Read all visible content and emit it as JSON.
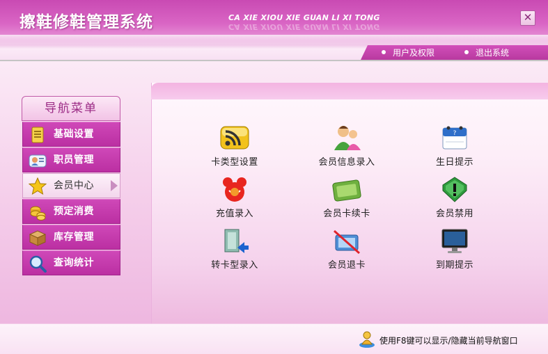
{
  "window": {
    "title": "擦鞋修鞋管理系统",
    "subtitle": "CA XIE XIOU XIE GUAN LI XI TONG",
    "close_label": "✕"
  },
  "header_links": [
    {
      "label": "用户及权限"
    },
    {
      "label": "退出系统"
    }
  ],
  "nav": {
    "title": "导航菜单",
    "items": [
      {
        "label": "基础设置",
        "icon": "document-icon"
      },
      {
        "label": "职员管理",
        "icon": "id-card-icon"
      },
      {
        "label": "会员中心",
        "icon": "star-icon",
        "active": true
      },
      {
        "label": "预定消费",
        "icon": "coins-icon"
      },
      {
        "label": "库存管理",
        "icon": "box-icon"
      },
      {
        "label": "查询统计",
        "icon": "magnifier-icon"
      }
    ]
  },
  "functions": [
    {
      "label": "卡类型设置",
      "icon": "rss-icon"
    },
    {
      "label": "会员信息录入",
      "icon": "users-icon"
    },
    {
      "label": "生日提示",
      "icon": "calendar-icon"
    },
    {
      "label": "充值录入",
      "icon": "mouse-icon"
    },
    {
      "label": "会员卡续卡",
      "icon": "card-icon"
    },
    {
      "label": "会员禁用",
      "icon": "shield-icon"
    },
    {
      "label": "转卡型录入",
      "icon": "transfer-icon"
    },
    {
      "label": "会员退卡",
      "icon": "card-remove-icon"
    },
    {
      "label": "到期提示",
      "icon": "monitor-icon"
    }
  ],
  "footer": {
    "hint": "使用F8键可以显示/隐藏当前导航窗口",
    "icon": "user-hint-icon"
  },
  "colors": {
    "brand": "#c94ab3",
    "nav_item": "#bb2fa2",
    "nav_active": "#f3d6ec"
  }
}
